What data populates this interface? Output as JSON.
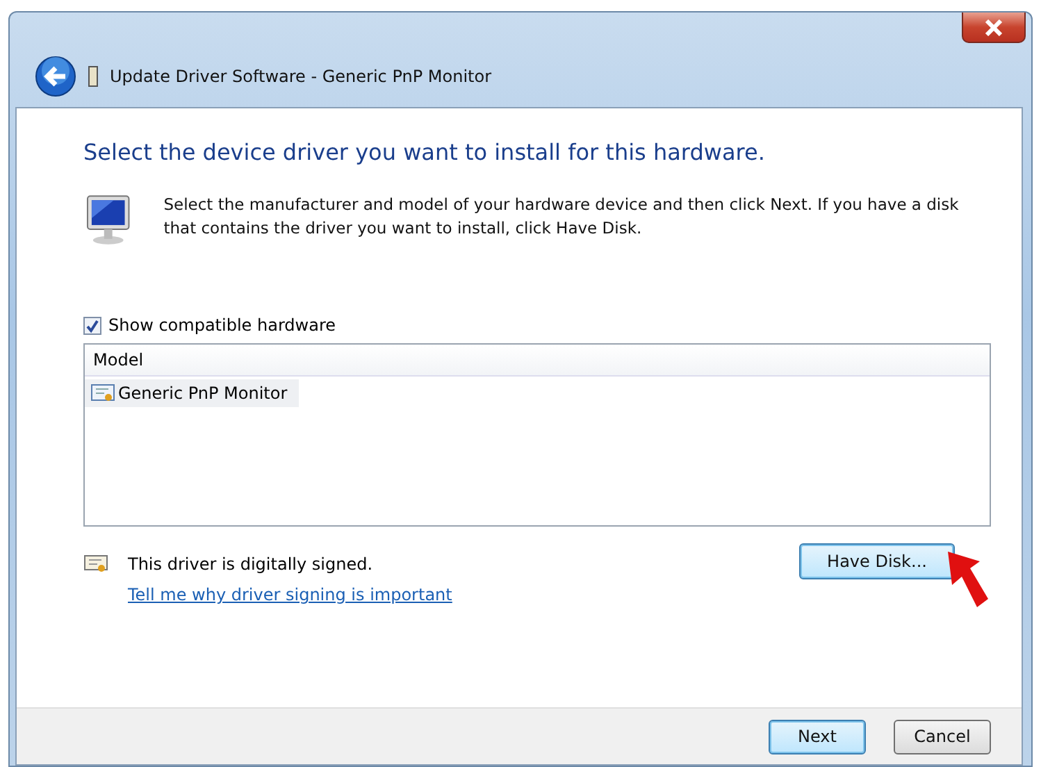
{
  "window": {
    "title": "Update Driver Software - Generic PnP Monitor"
  },
  "heading": "Select the device driver you want to install for this hardware.",
  "description": "Select the manufacturer and model of your hardware device and then click Next. If you have a disk that contains the driver you want to install, click Have Disk.",
  "show_compatible": {
    "label": "Show compatible hardware",
    "checked": true
  },
  "table": {
    "columns": [
      "Model"
    ],
    "rows": [
      {
        "name": "Generic PnP Monitor",
        "selected": true
      }
    ]
  },
  "signature": {
    "text": "This driver is digitally signed.",
    "link": "Tell me why driver signing is important"
  },
  "have_disk_button": {
    "label": "Have Disk...",
    "focused": true
  },
  "buttons": [
    {
      "label": "Next",
      "default": true
    },
    {
      "label": "Cancel",
      "default": false
    }
  ]
}
